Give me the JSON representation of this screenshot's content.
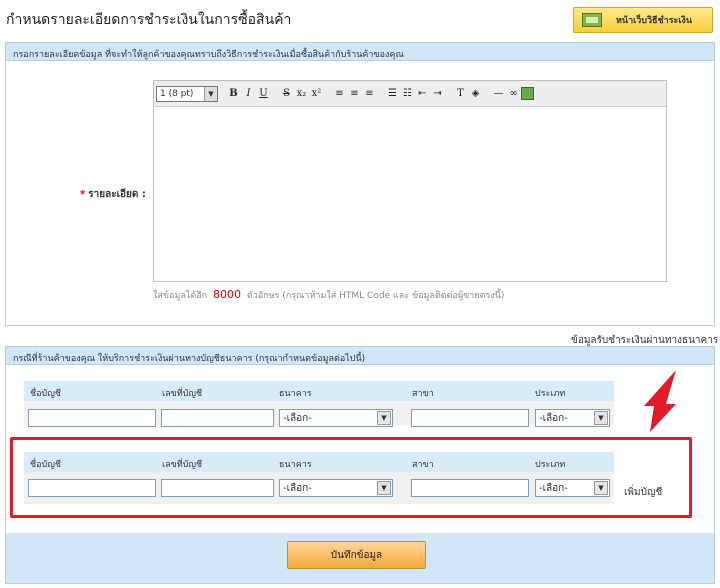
{
  "page": {
    "title": "กำหนดรายละเอียดการชำระเงินในการซื้อสินค้า",
    "payment_button": "หน้าเว็บวิธีชำระเงิน"
  },
  "details_panel": {
    "header": "กรอกรายละเอียดข้อมูล ที่จะทำให้ลูกค้าของคุณทราบถึงวิธีการชำระเงินเมื่อซื้อสินค้ากับร้านค้าของคุณ",
    "required_mark": "*",
    "label": "รายละเอียด :",
    "font_size": "1 (8 pt)",
    "toolbar_icons": [
      "bold-icon",
      "italic-icon",
      "underline-icon",
      "strikethrough-icon",
      "subscript-icon",
      "superscript-icon",
      "align-left-icon",
      "align-center-icon",
      "align-right-icon",
      "ordered-list-icon",
      "unordered-list-icon",
      "outdent-icon",
      "indent-icon",
      "text-color-icon",
      "background-color-icon",
      "horizontal-rule-icon",
      "link-icon",
      "image-icon"
    ],
    "char_info_prefix": "ใส่ข้อมูลได้อีก",
    "char_count": "8000",
    "char_info_suffix": "ตัวอักษร (กรุณาห้ามใส่ HTML Code และ ข้อมูลติดต่อผู้ขายตรงนี้)"
  },
  "bank_section": {
    "caption": "ข้อมูลรับชำระเงินผ่านทางธนาคาร",
    "header": "กรณีที่ร้านค้าของคุณ ให้บริการชำระเงินผ่านทางบัญชีธนาคาร (กรุณากำหนดข้อมูลต่อไปนี้)",
    "columns": [
      "ชื่อบัญชี",
      "เลขที่บัญชี",
      "ธนาคาร",
      "สาขา",
      "ประเภท"
    ],
    "bank_select": "-เลือก-",
    "type_select": "-เลือก-",
    "add_account": "เพิ่มบัญชี",
    "save_button": "บันทึกข้อมูล"
  },
  "colors": {
    "highlight": "#e21b2b",
    "panel_header": "#cfe7f6",
    "accent_yellow": "#f6cf3f",
    "accent_orange": "#f5a93a"
  }
}
